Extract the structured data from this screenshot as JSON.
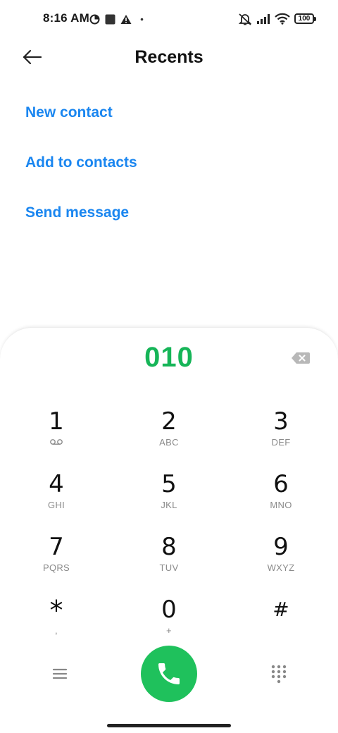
{
  "status_bar": {
    "time": "8:16 AM",
    "battery": "100",
    "icons": [
      "data-saver-icon",
      "stop-icon",
      "warning-icon",
      "dot-icon",
      "ringer-off-icon",
      "signal-icon",
      "wifi-icon",
      "battery-icon"
    ]
  },
  "header": {
    "title": "Recents",
    "back_icon": "arrow-left-icon"
  },
  "actions": [
    {
      "label": "New contact"
    },
    {
      "label": "Add to contacts"
    },
    {
      "label": "Send message"
    }
  ],
  "dialer": {
    "number": "010",
    "backspace_icon": "backspace-icon",
    "keys": [
      {
        "digit": "1",
        "letters": "",
        "icon": "voicemail-icon"
      },
      {
        "digit": "2",
        "letters": "ABC"
      },
      {
        "digit": "3",
        "letters": "DEF"
      },
      {
        "digit": "4",
        "letters": "GHI"
      },
      {
        "digit": "5",
        "letters": "JKL"
      },
      {
        "digit": "6",
        "letters": "MNO"
      },
      {
        "digit": "7",
        "letters": "PQRS"
      },
      {
        "digit": "8",
        "letters": "TUV"
      },
      {
        "digit": "9",
        "letters": "WXYZ"
      },
      {
        "digit": "*",
        "letters": ","
      },
      {
        "digit": "0",
        "letters": "+"
      },
      {
        "digit": "#",
        "letters": ""
      }
    ],
    "bottom_icons": {
      "menu": "menu-icon",
      "call": "phone-icon",
      "keypad": "dialpad-icon"
    }
  },
  "colors": {
    "accent_blue": "#1a86f0",
    "number_green": "#16b558",
    "call_green": "#1fc15c",
    "muted_gray": "#8a8a8a"
  }
}
